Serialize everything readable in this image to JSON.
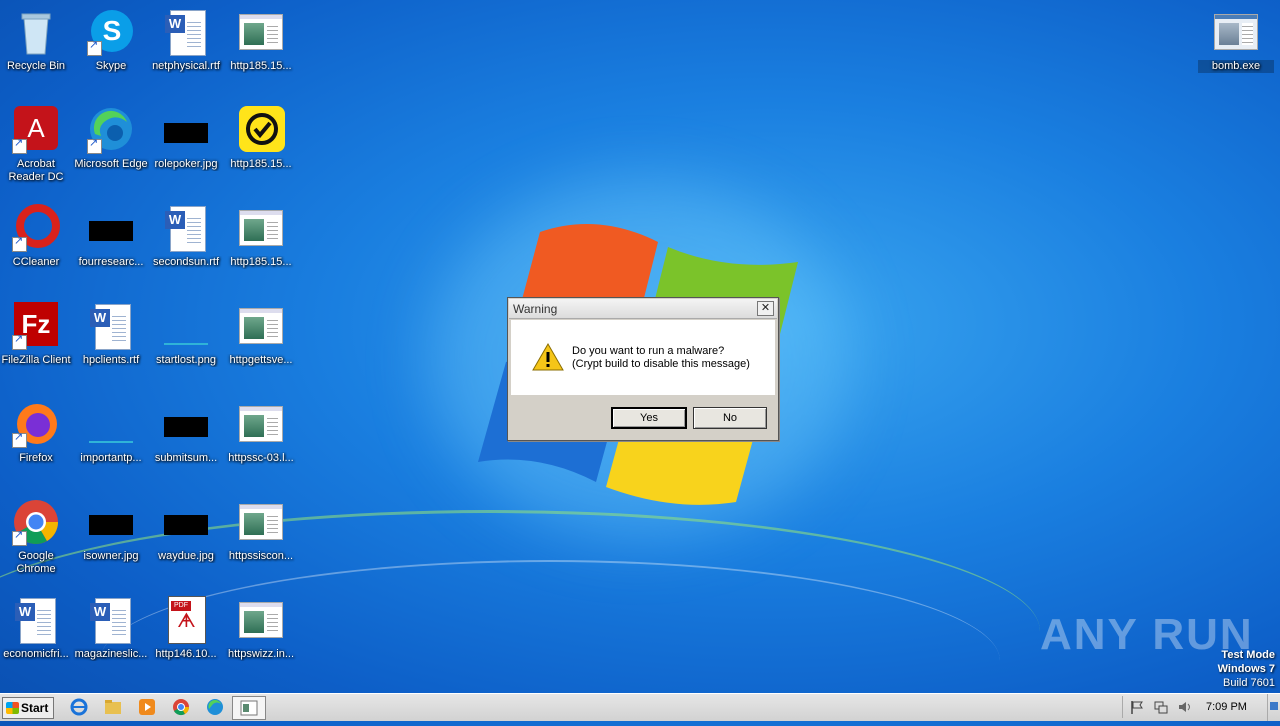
{
  "desktop": {
    "icons": [
      {
        "label": "Recycle Bin"
      },
      {
        "label": "Skype"
      },
      {
        "label": "netphysical.rtf"
      },
      {
        "label": "http185.15..."
      },
      {
        "label": "Acrobat Reader DC"
      },
      {
        "label": "Microsoft Edge"
      },
      {
        "label": "rolepoker.jpg"
      },
      {
        "label": "http185.15..."
      },
      {
        "label": "CCleaner"
      },
      {
        "label": "fourresearc..."
      },
      {
        "label": "secondsun.rtf"
      },
      {
        "label": "http185.15..."
      },
      {
        "label": "FileZilla Client"
      },
      {
        "label": "hpclients.rtf"
      },
      {
        "label": "startlost.png"
      },
      {
        "label": "httpgettsve..."
      },
      {
        "label": "Firefox"
      },
      {
        "label": "importantp..."
      },
      {
        "label": "submitsum..."
      },
      {
        "label": "httpssc-03.l..."
      },
      {
        "label": "Google Chrome"
      },
      {
        "label": "isowner.jpg"
      },
      {
        "label": "waydue.jpg"
      },
      {
        "label": "httpssiscon..."
      },
      {
        "label": "economicfri..."
      },
      {
        "label": "magazineslic..."
      },
      {
        "label": "http146.10..."
      },
      {
        "label": "httpswizz.in..."
      },
      {
        "label": "bomb.exe"
      }
    ]
  },
  "dialog": {
    "title": "Warning",
    "close": "✕",
    "message_line1": "Do you want to run a malware?",
    "message_line2": "(Crypt build to disable this message)",
    "yes_label": "Yes",
    "no_label": "No"
  },
  "watermark": {
    "text": "ANY RUN",
    "test_mode": "Test Mode",
    "os": "Windows 7",
    "build": "Build 7601"
  },
  "taskbar": {
    "start_label": "Start",
    "time": "7:09 PM"
  },
  "colors": {
    "desktop_blue": "#1a7fe0",
    "dialog_gray": "#d4d0c8",
    "warning_yellow": "#f5c518"
  }
}
